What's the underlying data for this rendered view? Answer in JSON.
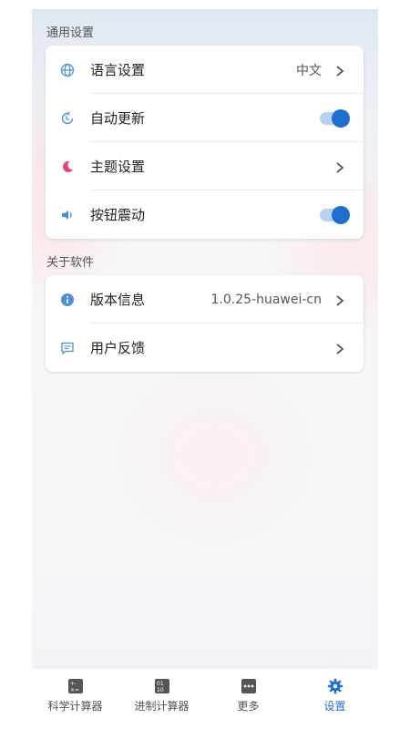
{
  "sections": {
    "general_title": "通用设置",
    "about_title": "关于软件"
  },
  "general": {
    "language_label": "语言设置",
    "language_value": "中文",
    "auto_update_label": "自动更新",
    "auto_update_on": true,
    "theme_label": "主题设置",
    "vibration_label": "按钮震动",
    "vibration_on": true
  },
  "about": {
    "version_label": "版本信息",
    "version_value": "1.0.25-huawei-cn",
    "feedback_label": "用户反馈"
  },
  "tabs": [
    {
      "label": "科学计算器",
      "icon": "calculator-icon",
      "active": false
    },
    {
      "label": "进制计算器",
      "icon": "binary-calculator-icon",
      "active": false
    },
    {
      "label": "更多",
      "icon": "more-icon",
      "active": false
    },
    {
      "label": "设置",
      "icon": "gear-icon",
      "active": true
    }
  ],
  "colors": {
    "accent": "#1f6fd1",
    "icon_blue": "#4a90d9",
    "theme_pink": "#e8407a",
    "toggle_track": "#b7d2f0"
  }
}
